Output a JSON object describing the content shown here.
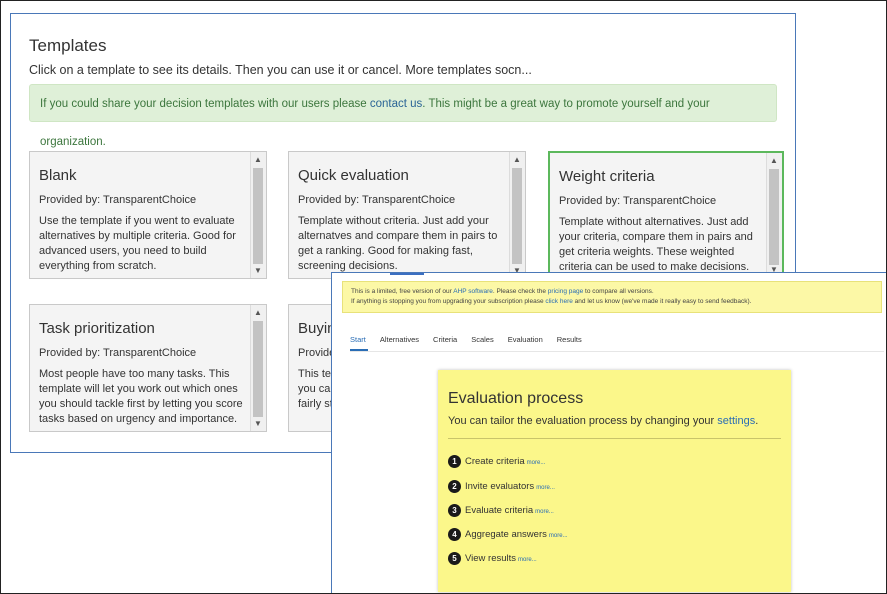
{
  "templates": {
    "title": "Templates",
    "subtitle": "Click on a template to see its details. Then you can use it or cancel. More templates socn...",
    "share": {
      "text_before": "If you could share your decision templates with our users please ",
      "link": "contact us",
      "text_after": ". This might be a great way to promote yourself and your organization."
    },
    "cards": [
      {
        "title": "Blank",
        "provider": "Provided by: TransparentChoice",
        "desc": "Use the template if you went to evaluate alternatives by multiple criteria. Good for advanced users, you need to build everything from scratch.",
        "selected": false
      },
      {
        "title": "Quick evaluation",
        "provider": "Provided by: TransparentChoice",
        "desc": "Template without criteria. Just add your alternatves and compare them in pairs to get a ranking. Good for making fast, screening decisions.",
        "selected": false
      },
      {
        "title": "Weight criteria",
        "provider": "Provided by: TransparentChoice",
        "desc": "Template without alternatives. Just add your criteria, compare them in pairs and get criteria weights. These weighted criteria can be used to make decisions.",
        "selected": true
      },
      {
        "title": "Task prioritization",
        "provider": "Provided by: TransparentChoice",
        "desc": "Most people have too many tasks. This template will let you work out which ones you should tackle first by letting you score tasks based on urgency and importance.",
        "selected": false
      },
      {
        "title": "Buying",
        "provider": "Provide",
        "desc": "This ten you car fairly st",
        "selected": false
      }
    ]
  },
  "app": {
    "notice": {
      "line1_a": "This is a limited, free version of our ",
      "line1_link1": "AHP software",
      "line1_b": ". Please check the ",
      "line1_link2": "pricing page",
      "line1_c": " to compare all versions.",
      "line2_a": "If anything is stopping you from upgrading your subscription please ",
      "line2_link": "click here",
      "line2_b": " and let us know (we've made it really easy to send feedback)."
    },
    "tabs": [
      "Start",
      "Alternatives",
      "Criteria",
      "Scales",
      "Evaluation",
      "Results"
    ],
    "active_tab": "Start",
    "process": {
      "title": "Evaluation process",
      "subtitle_a": "You can tailor the evaluation process by changing your ",
      "subtitle_link": "settings",
      "subtitle_b": ".",
      "steps": [
        {
          "num": "1",
          "label": "Create criteria",
          "more": "more..."
        },
        {
          "num": "2",
          "label": "Invite evaluators",
          "more": "more..."
        },
        {
          "num": "3",
          "label": "Evaluate criteria",
          "more": "more..."
        },
        {
          "num": "4",
          "label": "Aggregate answers",
          "more": "more..."
        },
        {
          "num": "5",
          "label": "View results",
          "more": "more..."
        }
      ]
    }
  },
  "colors": {
    "accent_blue": "#2a6db5",
    "success_green": "#5cb85c",
    "notice_yellow": "#fcf8a6",
    "process_yellow": "#fbf78a",
    "share_green_bg": "#dff0d8"
  }
}
